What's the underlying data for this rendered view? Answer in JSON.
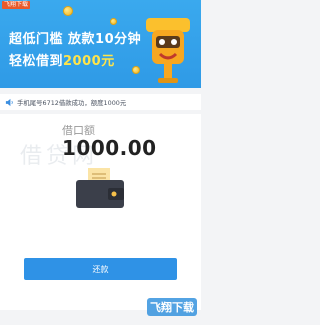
{
  "watermark_top": "飞翔下载",
  "banner": {
    "line1": "超低门槛  放款10分钟",
    "line2_prefix": "轻松借到",
    "line2_amount": "2000元"
  },
  "notice": {
    "icon": "speaker-icon",
    "text": "手机尾号6712借款成功，额度1000元"
  },
  "loan": {
    "label": "借口额",
    "amount": "1000.00",
    "watermark": "借贷网"
  },
  "repay_label": "还款",
  "watermark_bottom": "飞翔下载",
  "colors": {
    "brand_blue": "#2f92e6",
    "highlight_yellow": "#ffe44a"
  }
}
